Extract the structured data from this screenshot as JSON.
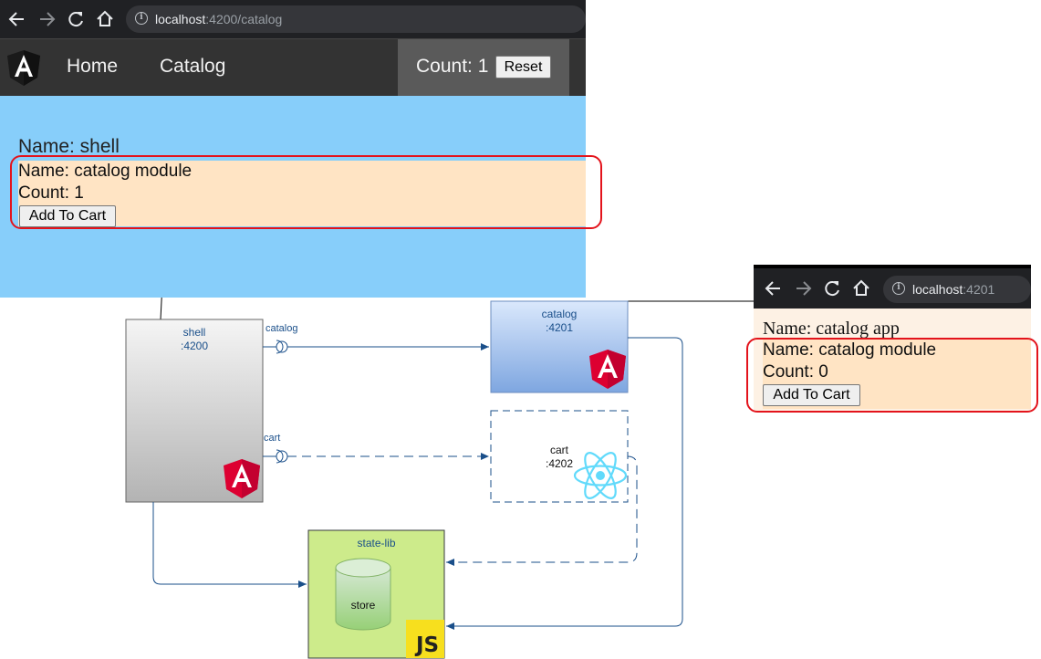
{
  "shell_window": {
    "url_host": "localhost",
    "url_rest": ":4200/catalog",
    "nav": {
      "home": "Home",
      "catalog": "Catalog"
    },
    "count_label": "Count: 1",
    "reset_label": "Reset",
    "shell_name": "Name: shell",
    "module": {
      "name": "Name: catalog module",
      "count": "Count: 1",
      "add_label": "Add To Cart"
    }
  },
  "catalog_window": {
    "url_host": "localhost",
    "url_rest": ":4201",
    "app_name": "Name: catalog app",
    "module": {
      "name": "Name: catalog module",
      "count": "Count: 0",
      "add_label": "Add To Cart"
    }
  },
  "diagram": {
    "nodes": {
      "shell": {
        "name": "shell",
        "port": ":4200"
      },
      "catalog": {
        "name": "catalog",
        "port": ":4201"
      },
      "cart": {
        "name": "cart",
        "port": ":4202"
      },
      "state_lib": {
        "name": "state-lib"
      },
      "store": {
        "name": "store"
      }
    },
    "edges": {
      "catalog": "catalog",
      "cart": "cart"
    },
    "badges": {
      "js": "JS"
    },
    "colors": {
      "line": "#1a4f8a",
      "angular_red": "#dd0031",
      "react_cyan": "#61dafb",
      "state_green": "#cdeb8b",
      "catalog_blue": "#7ea6e0",
      "callout_red": "#e3131b"
    }
  }
}
